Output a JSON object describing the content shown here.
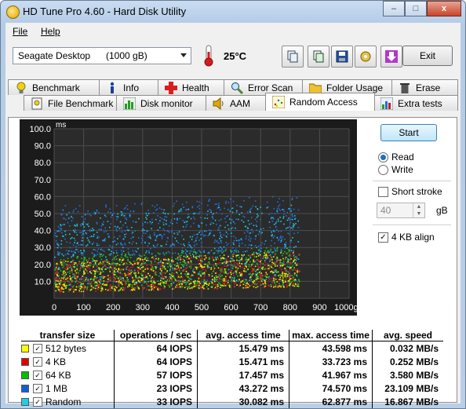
{
  "window": {
    "title": "HD Tune Pro 4.60 - Hard Disk Utility",
    "min_glyph": "–",
    "max_glyph": "□",
    "close_glyph": "x"
  },
  "menu": {
    "file": "File",
    "help": "Help"
  },
  "toolbar": {
    "drive_name": "Seagate Desktop",
    "drive_capacity": "(1000 gB)",
    "temperature": "25°C",
    "exit_label": "Exit"
  },
  "tabs_row1": [
    {
      "label": "Benchmark",
      "icon": "benchmark-bulb-icon"
    },
    {
      "label": "Info",
      "icon": "info-icon"
    },
    {
      "label": "Health",
      "icon": "health-cross-icon"
    },
    {
      "label": "Error Scan",
      "icon": "error-scan-magnifier-icon"
    },
    {
      "label": "Folder Usage",
      "icon": "folder-icon"
    },
    {
      "label": "Erase",
      "icon": "trash-icon"
    }
  ],
  "tabs_row2": [
    {
      "label": "File Benchmark",
      "icon": "file-benchmark-icon"
    },
    {
      "label": "Disk monitor",
      "icon": "disk-monitor-icon"
    },
    {
      "label": "AAM",
      "icon": "speaker-icon"
    },
    {
      "label": "Random Access",
      "icon": "random-access-icon",
      "active": true
    },
    {
      "label": "Extra tests",
      "icon": "extra-tests-icon"
    }
  ],
  "side": {
    "start_label": "Start",
    "read_label": "Read",
    "write_label": "Write",
    "read_selected": true,
    "short_stroke_label": "Short stroke",
    "short_stroke_checked": false,
    "stroke_value": "40",
    "stroke_unit": "gB",
    "align_label": "4 KB align",
    "align_checked": true
  },
  "chart_data": {
    "type": "scatter",
    "ylabel": "ms",
    "yticks": [
      "100.0",
      "90.0",
      "80.0",
      "70.0",
      "60.0",
      "50.0",
      "40.0",
      "30.0",
      "20.0",
      "10.0"
    ],
    "xticks": [
      "0",
      "100",
      "200",
      "300",
      "400",
      "500",
      "600",
      "700",
      "800",
      "900",
      "1000gB"
    ],
    "xlim": [
      0,
      1000
    ],
    "ylim": [
      0,
      100
    ],
    "grid": true,
    "series": [
      {
        "name": "512 bytes",
        "color": "#f2f200",
        "y_min": 4,
        "y_max": 22
      },
      {
        "name": "4 KB",
        "color": "#e02020",
        "y_min": 4,
        "y_max": 22
      },
      {
        "name": "64 KB",
        "color": "#20c020",
        "y_min": 5,
        "y_max": 25
      },
      {
        "name": "1 MB",
        "color": "#2070e0",
        "y_min": 25,
        "y_max": 55
      },
      {
        "name": "Random",
        "color": "#20c8e0",
        "y_min": 8,
        "y_max": 50
      }
    ]
  },
  "table": {
    "headers": [
      "transfer size",
      "operations / sec",
      "avg. access time",
      "max. access time",
      "avg. speed"
    ],
    "rows": [
      {
        "label": "512 bytes",
        "color": "#ffff00",
        "ops": "64 IOPS",
        "avg": "15.479 ms",
        "max": "43.598 ms",
        "speed": "0.032 MB/s"
      },
      {
        "label": "4 KB",
        "color": "#e00000",
        "ops": "64 IOPS",
        "avg": "15.471 ms",
        "max": "33.723 ms",
        "speed": "0.252 MB/s"
      },
      {
        "label": "64 KB",
        "color": "#00c000",
        "ops": "57 IOPS",
        "avg": "17.457 ms",
        "max": "41.967 ms",
        "speed": "3.580 MB/s"
      },
      {
        "label": "1 MB",
        "color": "#1060d0",
        "ops": "23 IOPS",
        "avg": "43.272 ms",
        "max": "74.570 ms",
        "speed": "23.109 MB/s"
      },
      {
        "label": "Random",
        "color": "#20d0e0",
        "ops": "33 IOPS",
        "avg": "30.082 ms",
        "max": "62.877 ms",
        "speed": "16.867 MB/s"
      }
    ]
  }
}
